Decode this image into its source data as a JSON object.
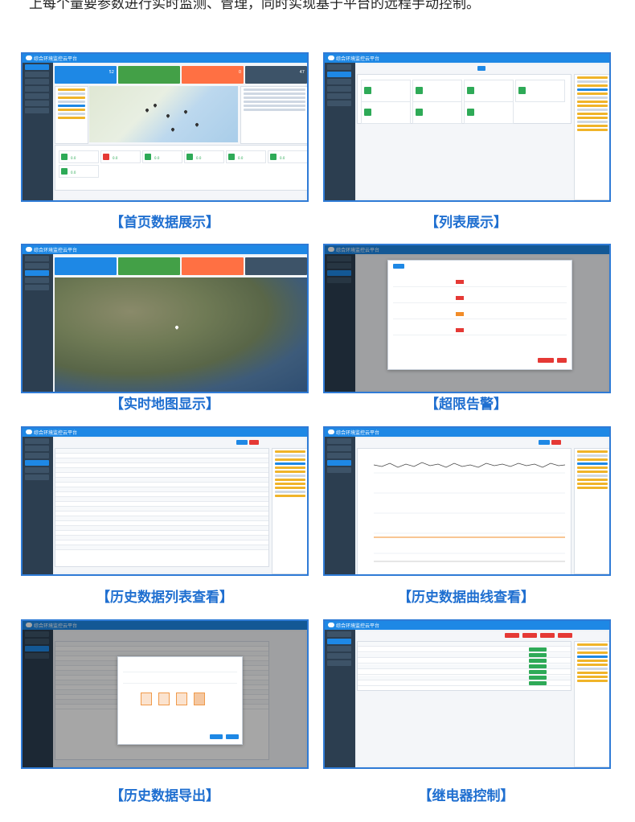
{
  "intro_text": "上每个量要参数进行实时监测、管理，同时实现基于平台的远程手动控制。",
  "app": {
    "name": "综合环境监控云平台"
  },
  "colors": {
    "accent": "#1e88e5",
    "caption": "#1f6fd0",
    "frame": "#2f7bd6",
    "ok": "#2eaa57",
    "alarm": "#e53935",
    "warn": "#ff7043"
  },
  "screens": [
    {
      "id": "home",
      "caption": "【首页数据展示】"
    },
    {
      "id": "list",
      "caption": "【列表展示】"
    },
    {
      "id": "map",
      "caption": "【实时地图显示】"
    },
    {
      "id": "alarm",
      "caption": "【超限告警】"
    },
    {
      "id": "history-list",
      "caption": "【历史数据列表查看】"
    },
    {
      "id": "history-curve",
      "caption": "【历史数据曲线查看】"
    },
    {
      "id": "export",
      "caption": "【历史数据导出】"
    },
    {
      "id": "relay",
      "caption": "【继电器控制】"
    }
  ],
  "home": {
    "tiles": [
      {
        "value": "52",
        "color": "#1e88e5"
      },
      {
        "value": "",
        "color": "#43a047"
      },
      {
        "value": "0",
        "color": "#ff7043"
      },
      {
        "value": "47",
        "color": "#3d5368"
      }
    ],
    "sensor_values": [
      "0.0",
      "0.0",
      "0.0",
      "0.0",
      "0.0",
      "0.0",
      "0.0"
    ]
  },
  "icons": [
    "cloud-icon",
    "bell-icon",
    "leaf-icon",
    "signal-off-icon",
    "map-pin-icon",
    "gear-icon",
    "user-icon"
  ]
}
